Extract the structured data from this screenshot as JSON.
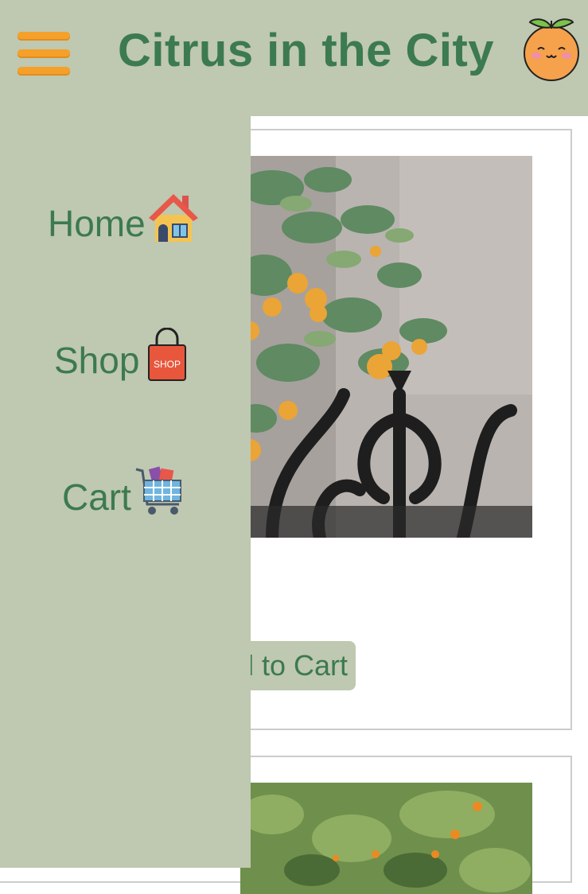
{
  "header": {
    "title": "Citrus in the City",
    "menu_icon": "hamburger-menu-icon",
    "logo_icon": "kawaii-orange-icon"
  },
  "sidebar": {
    "items": [
      {
        "label": "Home",
        "icon": "house-icon"
      },
      {
        "label": "Shop",
        "icon": "shop-bag-icon"
      },
      {
        "label": "Cart",
        "icon": "shopping-cart-icon"
      }
    ]
  },
  "products": [
    {
      "image": "potted-kumquat-tree-photo",
      "button_label": "Add to Cart"
    },
    {
      "image": "orange-tree-photo"
    }
  ],
  "colors": {
    "header_bg": "#bfc8b0",
    "title_green": "#3c7a50",
    "menu_orange": "#f5a02a",
    "button_bg": "#bfc8b0"
  }
}
